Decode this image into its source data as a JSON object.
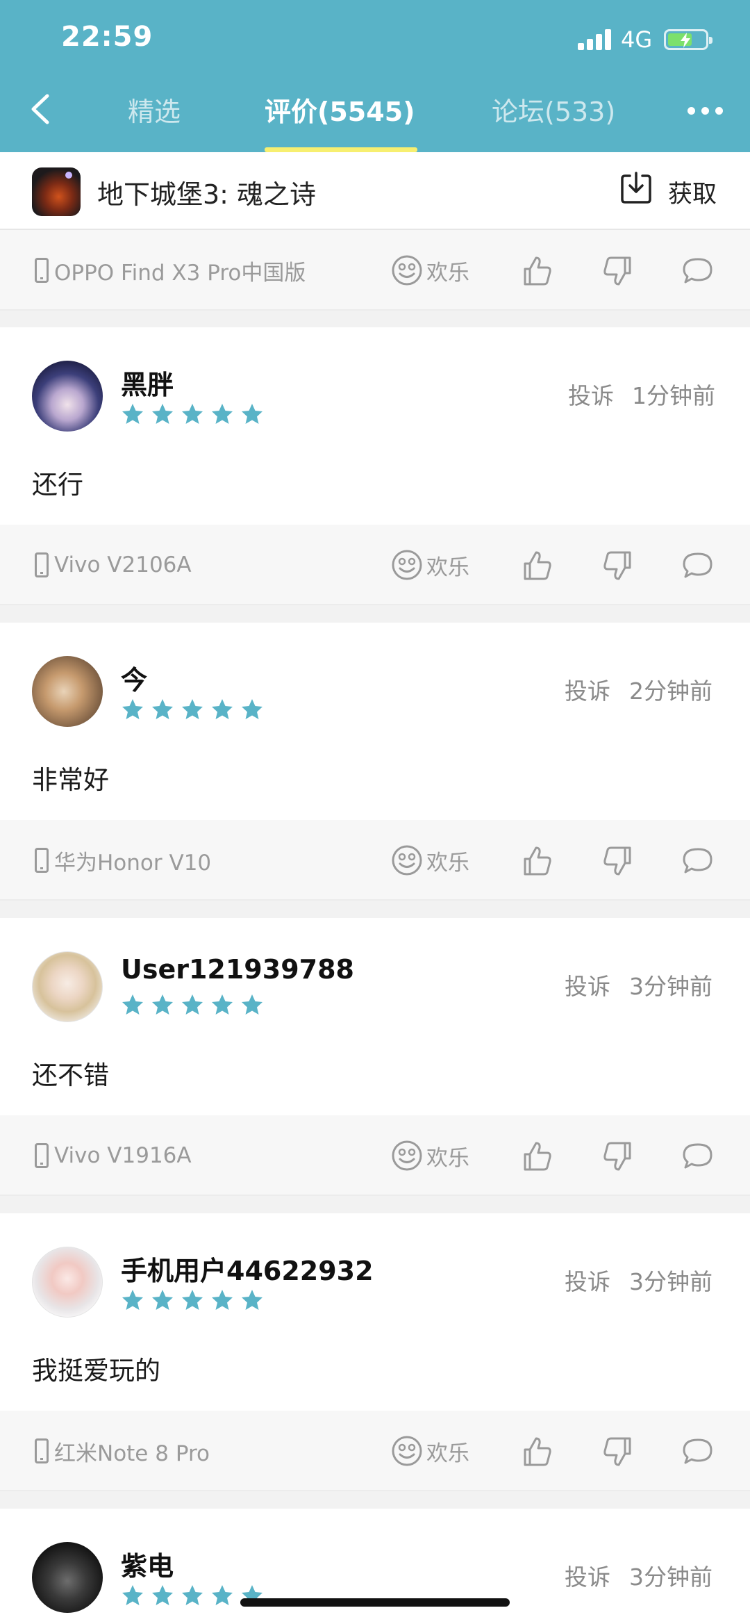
{
  "status_bar": {
    "time": "22:59",
    "network": "4G"
  },
  "nav": {
    "tabs": [
      {
        "label": "精选",
        "active": false
      },
      {
        "label": "评价(5545)",
        "active": true
      },
      {
        "label": "论坛(533)",
        "active": false
      }
    ]
  },
  "app": {
    "title": "地下城堡3: 魂之诗",
    "get_label": "获取"
  },
  "colors": {
    "header": "#59b3c7",
    "star": "#59b3c7",
    "tab_underline": "#f7ef70"
  },
  "top_bar": {
    "device": "OPPO Find X3 Pro中国版",
    "mood": "欢乐"
  },
  "reviews": [
    {
      "username": "黑胖",
      "rating": 5,
      "report": "投诉",
      "time": "1分钟前",
      "content": "还行",
      "device": "Vivo V2106A",
      "mood": "欢乐"
    },
    {
      "username": "今",
      "rating": 5,
      "report": "投诉",
      "time": "2分钟前",
      "content": "非常好",
      "device": "华为Honor V10",
      "mood": "欢乐"
    },
    {
      "username": "User121939788",
      "rating": 5,
      "report": "投诉",
      "time": "3分钟前",
      "content": "还不错",
      "device": "Vivo V1916A",
      "mood": "欢乐"
    },
    {
      "username": "手机用户44622932",
      "rating": 5,
      "report": "投诉",
      "time": "3分钟前",
      "content": "我挺爱玩的",
      "device": "红米Note 8 Pro",
      "mood": "欢乐"
    },
    {
      "username": "紫电",
      "rating": 5,
      "report": "投诉",
      "time": "3分钟前"
    }
  ]
}
